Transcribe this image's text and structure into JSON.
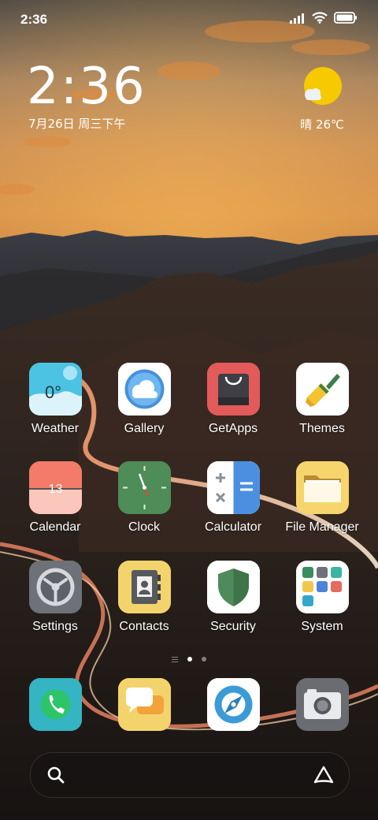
{
  "status_bar": {
    "time": "2:36",
    "icons": [
      "signal-icon",
      "wifi-icon",
      "battery-icon"
    ]
  },
  "clock_widget": {
    "time": "2:36",
    "date": "7月26日 周三下午"
  },
  "weather_widget": {
    "text": "晴 26℃",
    "icon": "sun-cloud-icon"
  },
  "apps": [
    {
      "label": "Weather",
      "icon": "weather-icon",
      "badge": "0°"
    },
    {
      "label": "Gallery",
      "icon": "gallery-icon"
    },
    {
      "label": "GetApps",
      "icon": "getapps-icon"
    },
    {
      "label": "Themes",
      "icon": "themes-brush-icon"
    },
    {
      "label": "Calendar",
      "icon": "calendar-icon",
      "badge": "13"
    },
    {
      "label": "Clock",
      "icon": "clock-icon"
    },
    {
      "label": "Calculator",
      "icon": "calculator-icon"
    },
    {
      "label": "File Manager",
      "icon": "folder-icon"
    },
    {
      "label": "Settings",
      "icon": "settings-icon"
    },
    {
      "label": "Contacts",
      "icon": "contacts-icon"
    },
    {
      "label": "Security",
      "icon": "security-shield-icon"
    },
    {
      "label": "System",
      "icon": "system-folder-icon"
    }
  ],
  "page_indicator": {
    "pages": 2,
    "current": 1
  },
  "dock": [
    {
      "icon": "phone-icon"
    },
    {
      "icon": "messages-icon"
    },
    {
      "icon": "browser-icon"
    },
    {
      "icon": "camera-icon"
    }
  ],
  "search_bar": {
    "left_icon": "search-icon",
    "right_icon": "assistant-icon"
  }
}
